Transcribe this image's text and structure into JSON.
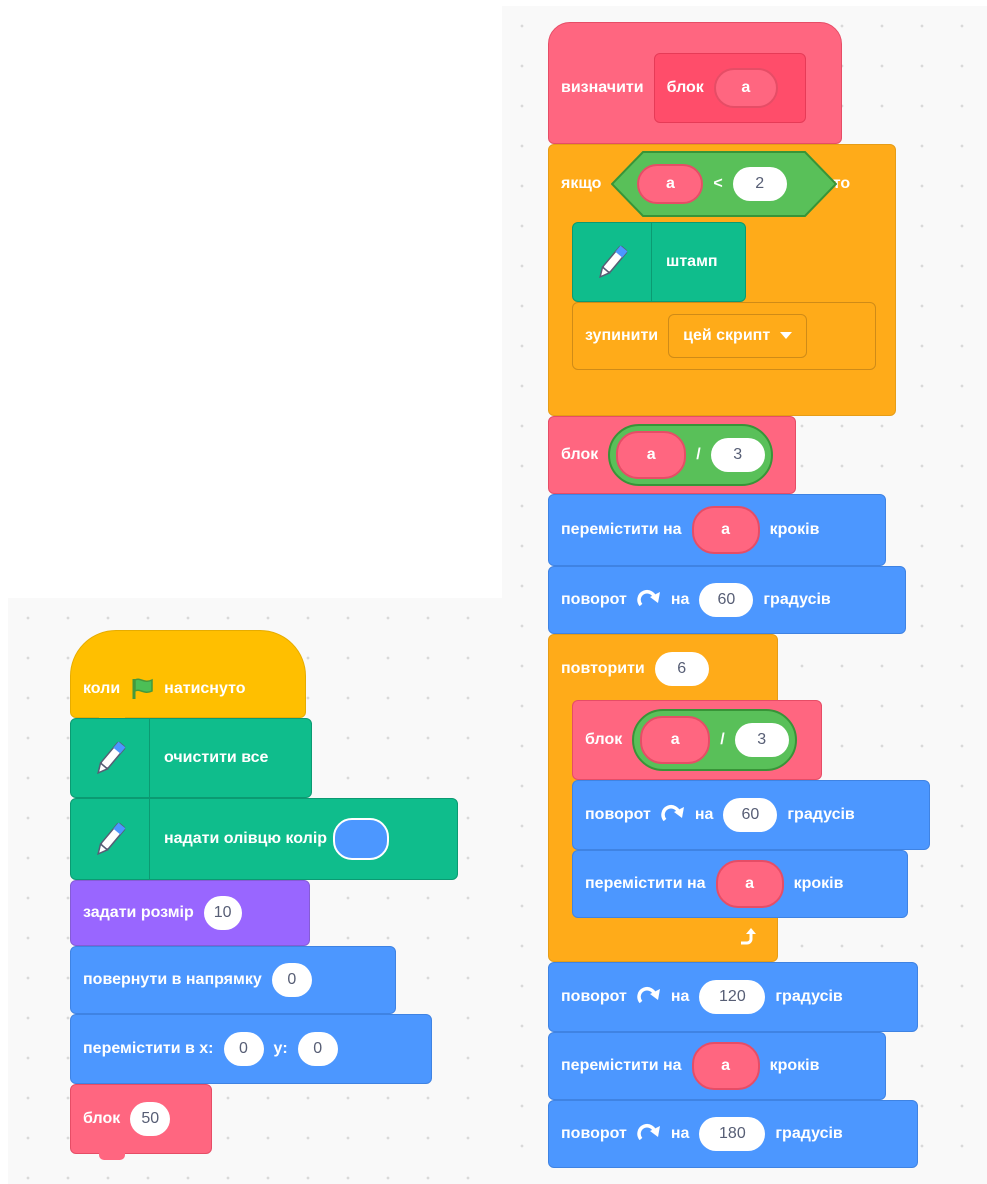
{
  "colors": {
    "events": "#ffbf00",
    "pen": "#0fbd8c",
    "motion": "#4c97ff",
    "looks": "#9966ff",
    "control": "#ffab19",
    "my_blocks": "#ff6680",
    "operators": "#59c059",
    "pen_color_swatch": "#4c97ff"
  },
  "icons": [
    "green-flag-icon",
    "pen-icon",
    "rotate-right-icon",
    "loop-arrow-icon",
    "dropdown-arrow-icon"
  ],
  "main_script": {
    "when_flag": {
      "left": "коли",
      "right": "натиснуто"
    },
    "clear": "очистити все",
    "set_pen_color": "надати олівцю колір",
    "set_size": {
      "label": "задати розмір",
      "value": "10"
    },
    "point_direction": {
      "label": "повернути в напрямку",
      "value": "0"
    },
    "go_to": {
      "label": "перемістити в x:",
      "x": "0",
      "y_label": "y:",
      "y": "0"
    },
    "call": {
      "label": "блок",
      "value": "50"
    }
  },
  "define_script": {
    "define": {
      "label": "визначити",
      "proto_label": "блок",
      "param": "a"
    },
    "if": {
      "label": "якщо",
      "left": "a",
      "op": "<",
      "right": "2",
      "then": "то"
    },
    "stamp": "штамп",
    "stop": {
      "label": "зупинити",
      "option": "цей скрипт"
    },
    "call_1": {
      "label": "блок",
      "left": "a",
      "op": "/",
      "right": "3"
    },
    "move_1": {
      "label": "перемістити на",
      "param": "a",
      "suffix": "кроків"
    },
    "turn_1": {
      "label": "поворот",
      "on": "на",
      "value": "60",
      "suffix": "градусів"
    },
    "repeat": {
      "label": "повторити",
      "value": "6"
    },
    "call_2": {
      "label": "блок",
      "left": "a",
      "op": "/",
      "right": "3"
    },
    "turn_2": {
      "label": "поворот",
      "on": "на",
      "value": "60",
      "suffix": "градусів"
    },
    "move_2": {
      "label": "перемістити на",
      "param": "a",
      "suffix": "кроків"
    },
    "turn_3": {
      "label": "поворот",
      "on": "на",
      "value": "120",
      "suffix": "градусів"
    },
    "move_3": {
      "label": "перемістити на",
      "param": "a",
      "suffix": "кроків"
    },
    "turn_4": {
      "label": "поворот",
      "on": "на",
      "value": "180",
      "suffix": "градусів"
    }
  }
}
